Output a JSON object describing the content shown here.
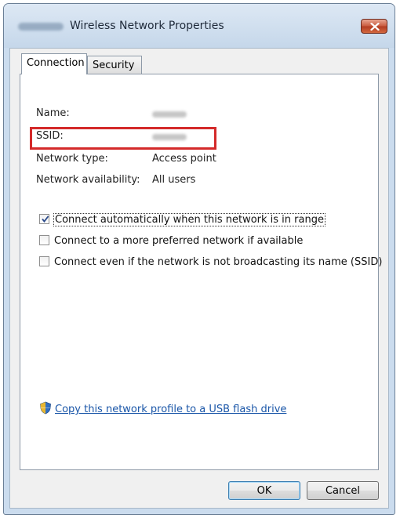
{
  "window": {
    "title": "Wireless Network Properties"
  },
  "tabs": [
    {
      "label": "Connection",
      "active": true
    },
    {
      "label": "Security",
      "active": false
    }
  ],
  "info": {
    "name_label": "Name:",
    "ssid_label": "SSID:",
    "network_type_label": "Network type:",
    "network_type_value": "Access point",
    "availability_label": "Network availability:",
    "availability_value": "All users"
  },
  "options": [
    {
      "label": "Connect automatically when this network is in range",
      "checked": true
    },
    {
      "label": "Connect to a more preferred network if available",
      "checked": false
    },
    {
      "label": "Connect even if the network is not broadcasting its name (SSID)",
      "checked": false
    }
  ],
  "link": {
    "label": "Copy this network profile to a USB flash drive",
    "icon": "shield-icon"
  },
  "buttons": {
    "ok": "OK",
    "cancel": "Cancel"
  },
  "colors": {
    "highlight": "#d42a2a",
    "link": "#1a56a8"
  }
}
